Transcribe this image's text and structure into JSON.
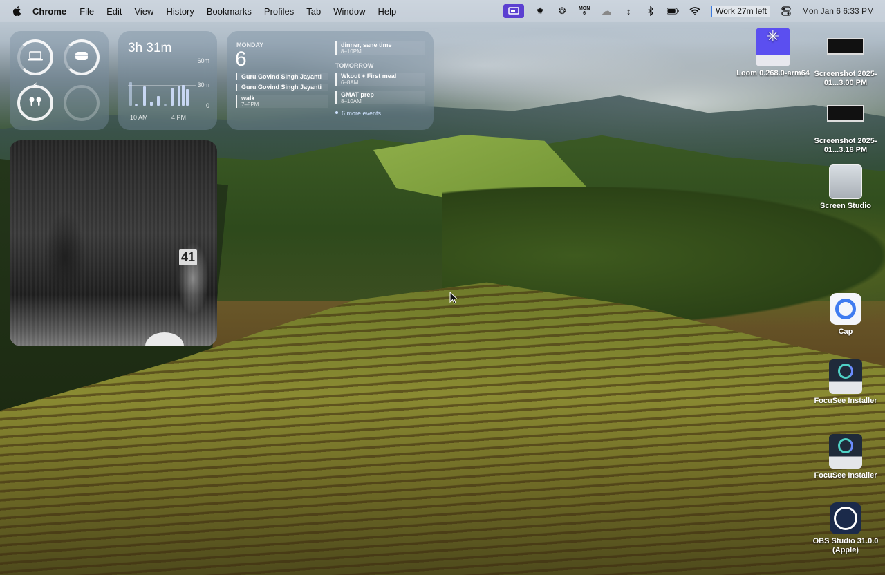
{
  "menubar": {
    "app_name": "Chrome",
    "items": [
      "File",
      "Edit",
      "View",
      "History",
      "Bookmarks",
      "Profiles",
      "Tab",
      "Window",
      "Help"
    ],
    "status": {
      "calendar_day": "MON",
      "calendar_date": "6",
      "work_timer": "Work 27m left",
      "clock": "Mon Jan 6  6:33 PM"
    }
  },
  "widgets": {
    "screen_time": {
      "total": "3h 31m",
      "y_labels": [
        "60m",
        "30m",
        "0"
      ],
      "x_labels": [
        "10 AM",
        "4 PM"
      ]
    },
    "calendar": {
      "day_name": "MONDAY",
      "day_number": "6",
      "today_events": [
        {
          "title": "Guru Govind Singh Jayanti",
          "time": ""
        },
        {
          "title": "Guru Govind Singh Jayanti",
          "time": ""
        },
        {
          "title": "walk",
          "time": "7–8PM"
        },
        {
          "title": "dinner, sane time",
          "time": "8–10PM"
        }
      ],
      "tomorrow_label": "TOMORROW",
      "tomorrow_events": [
        {
          "title": "Wkout + First meal",
          "time": "6–8AM"
        },
        {
          "title": "GMAT prep",
          "time": "8–10AM"
        }
      ],
      "more_events": "6 more events"
    },
    "photo": {
      "jersey_number": "41"
    }
  },
  "desktop_icons": [
    {
      "label": "Loom 0.268.0-arm64",
      "icon": "loom-disk-icon"
    },
    {
      "label": "Screenshot 2025-01...3.00 PM",
      "icon": "screenshot-icon"
    },
    {
      "label": "Screenshot 2025-01...3.18 PM",
      "icon": "screenshot-icon"
    },
    {
      "label": "Screen Studio",
      "icon": "drive-icon"
    },
    {
      "label": "Cap",
      "icon": "cap-app-icon"
    },
    {
      "label": "FocuSee Installer",
      "icon": "focusee-disk-icon"
    },
    {
      "label": "FocuSee Installer",
      "icon": "focusee-disk-icon"
    },
    {
      "label": "OBS Studio 31.0.0 (Apple)",
      "icon": "obs-app-icon"
    }
  ],
  "colors": {
    "accent_purple": "#5b3fd1",
    "work_timer_border": "#3b7be0"
  }
}
